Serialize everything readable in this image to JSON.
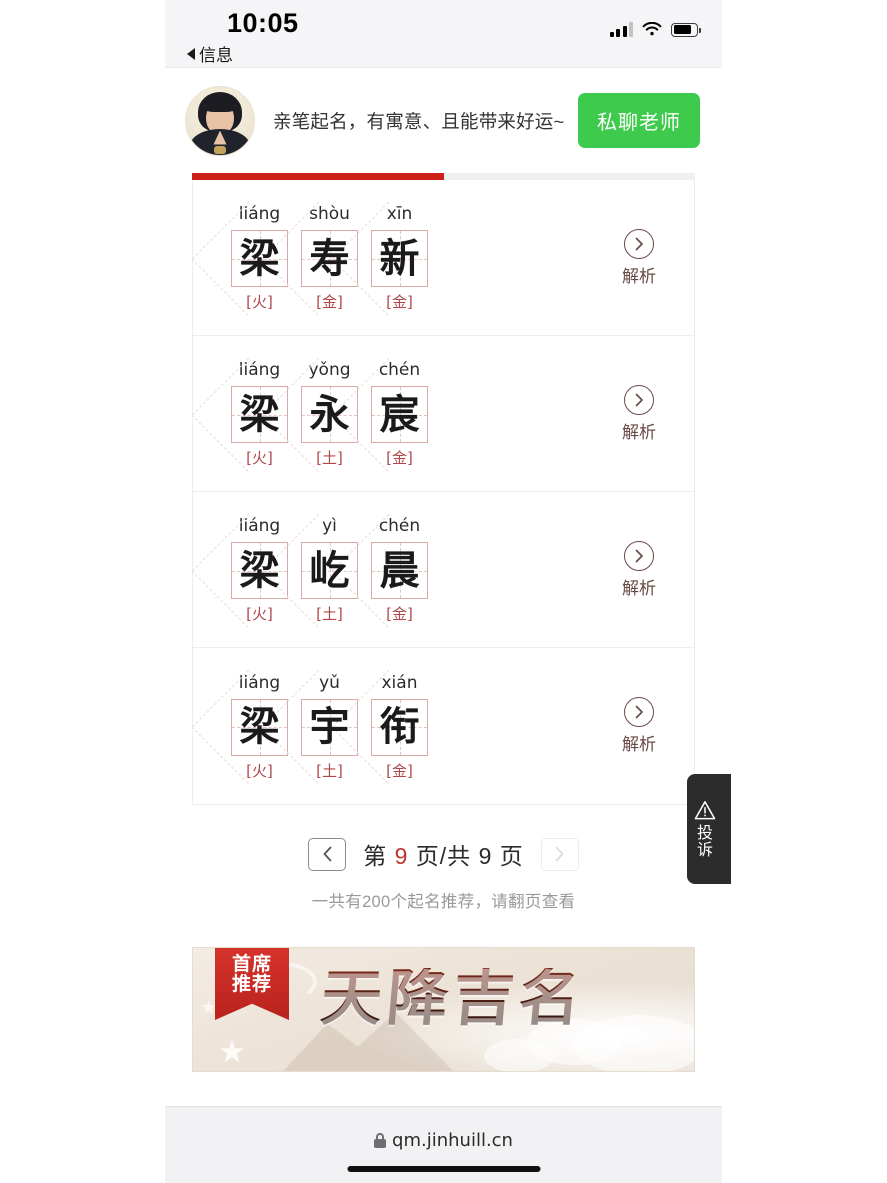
{
  "status_bar": {
    "time": "10:05",
    "back_label": "信息",
    "signal_icon": "signal-bars-icon",
    "wifi_icon": "wifi-icon",
    "battery_icon": "battery-icon"
  },
  "promo": {
    "avatar_alt": "teacher-avatar",
    "text": "亲笔起名，有寓意、且能带来好运~",
    "button_label": "私聊老师"
  },
  "progress": {
    "percent": 50
  },
  "results": [
    {
      "chars": [
        {
          "pinyin": "liáng",
          "hanzi": "梁",
          "element": "[火]"
        },
        {
          "pinyin": "shòu",
          "hanzi": "寿",
          "element": "[金]"
        },
        {
          "pinyin": "xīn",
          "hanzi": "新",
          "element": "[金]"
        }
      ],
      "action_label": "解析"
    },
    {
      "chars": [
        {
          "pinyin": "liáng",
          "hanzi": "梁",
          "element": "[火]"
        },
        {
          "pinyin": "yǒng",
          "hanzi": "永",
          "element": "[土]"
        },
        {
          "pinyin": "chén",
          "hanzi": "宸",
          "element": "[金]"
        }
      ],
      "action_label": "解析"
    },
    {
      "chars": [
        {
          "pinyin": "liáng",
          "hanzi": "梁",
          "element": "[火]"
        },
        {
          "pinyin": "yì",
          "hanzi": "屹",
          "element": "[土]"
        },
        {
          "pinyin": "chén",
          "hanzi": "晨",
          "element": "[金]"
        }
      ],
      "action_label": "解析"
    },
    {
      "chars": [
        {
          "pinyin": "liáng",
          "hanzi": "梁",
          "element": "[火]"
        },
        {
          "pinyin": "yǔ",
          "hanzi": "宇",
          "element": "[土]"
        },
        {
          "pinyin": "xián",
          "hanzi": "衔",
          "element": "[金]"
        }
      ],
      "action_label": "解析"
    }
  ],
  "pagination": {
    "prev_icon": "chevron-left-icon",
    "next_icon": "chevron-right-icon",
    "prefix": "第",
    "current_page": "9",
    "middle": "页/共",
    "total_pages": "9",
    "suffix": "页",
    "note": "一共有200个起名推荐，请翻页查看"
  },
  "ad_banner": {
    "ribbon_line1": "首席",
    "ribbon_line2": "推荐",
    "title": "天降吉名"
  },
  "complaint": {
    "icon": "warning-triangle-icon",
    "label": "投诉"
  },
  "browser": {
    "lock_icon": "lock-icon",
    "url": "qm.jinhuill.cn"
  },
  "colors": {
    "accent_red": "#cc2018",
    "element_red": "#b0484a",
    "promo_green": "#3ecb4d",
    "analyze_brown": "#6a4a46",
    "current_page_red": "#c0352c"
  }
}
